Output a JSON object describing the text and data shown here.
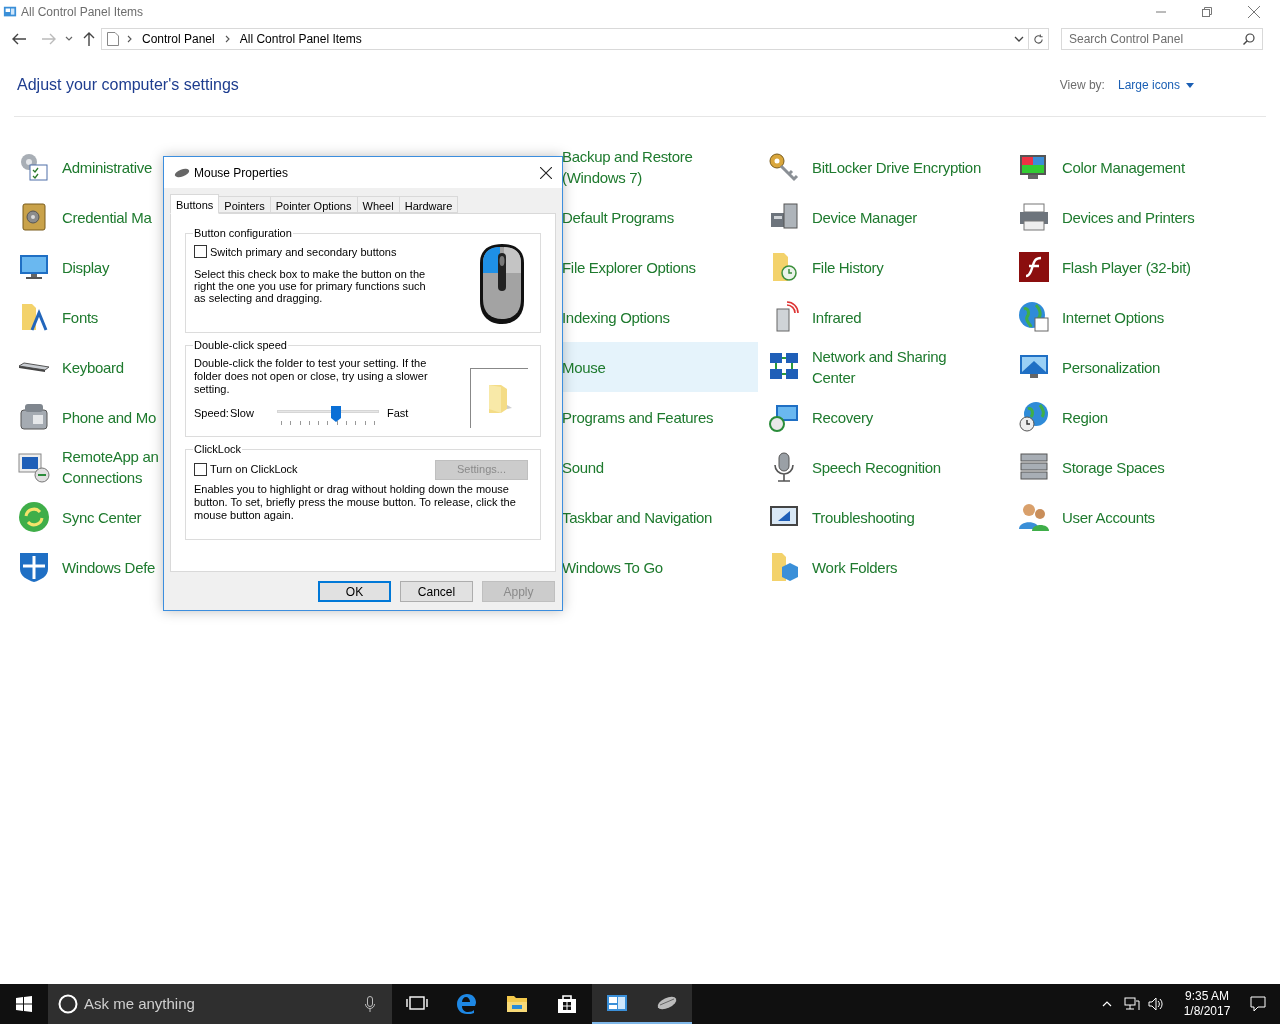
{
  "window": {
    "title": "All Control Panel Items"
  },
  "address_bar": {
    "breadcrumbs": [
      "Control Panel",
      "All Control Panel Items"
    ]
  },
  "search": {
    "placeholder": "Search Control Panel"
  },
  "heading": "Adjust your computer's settings",
  "view_by": {
    "label": "View by:",
    "value": "Large icons"
  },
  "columns": [
    {
      "items": [
        {
          "lines": [
            "Administrative"
          ],
          "selected": false
        },
        {
          "lines": [
            "Credential Ma"
          ],
          "selected": false
        },
        {
          "lines": [
            "Display"
          ],
          "selected": false
        },
        {
          "lines": [
            "Fonts"
          ],
          "selected": false
        },
        {
          "lines": [
            "Keyboard"
          ],
          "selected": false
        },
        {
          "lines": [
            "Phone and Mo"
          ],
          "selected": false
        },
        {
          "lines": [
            "RemoteApp an",
            "Connections"
          ],
          "selected": false
        },
        {
          "lines": [
            "Sync Center"
          ],
          "selected": false
        },
        {
          "lines": [
            "Windows Defe"
          ],
          "selected": false
        }
      ]
    },
    {
      "items": [
        {
          "lines": [
            "Backup and Restore",
            "(Windows 7)"
          ],
          "selected": false
        },
        {
          "lines": [
            "Default Programs"
          ],
          "selected": false
        },
        {
          "lines": [
            "File Explorer Options"
          ],
          "selected": false
        },
        {
          "lines": [
            "Indexing Options"
          ],
          "selected": false
        },
        {
          "lines": [
            "Mouse"
          ],
          "selected": true
        },
        {
          "lines": [
            "Programs and Features"
          ],
          "selected": false
        },
        {
          "lines": [
            "Sound"
          ],
          "selected": false
        },
        {
          "lines": [
            "Taskbar and Navigation"
          ],
          "selected": false
        },
        {
          "lines": [
            "Windows To Go"
          ],
          "selected": false
        }
      ]
    },
    {
      "items": [
        {
          "lines": [
            "BitLocker Drive Encryption"
          ],
          "selected": false
        },
        {
          "lines": [
            "Device Manager"
          ],
          "selected": false
        },
        {
          "lines": [
            "File History"
          ],
          "selected": false
        },
        {
          "lines": [
            "Infrared"
          ],
          "selected": false
        },
        {
          "lines": [
            "Network and Sharing",
            "Center"
          ],
          "selected": false
        },
        {
          "lines": [
            "Recovery"
          ],
          "selected": false
        },
        {
          "lines": [
            "Speech Recognition"
          ],
          "selected": false
        },
        {
          "lines": [
            "Troubleshooting"
          ],
          "selected": false
        },
        {
          "lines": [
            "Work Folders"
          ],
          "selected": false
        }
      ]
    },
    {
      "items": [
        {
          "lines": [
            "Color Management"
          ],
          "selected": false
        },
        {
          "lines": [
            "Devices and Printers"
          ],
          "selected": false
        },
        {
          "lines": [
            "Flash Player (32-bit)"
          ],
          "selected": false
        },
        {
          "lines": [
            "Internet Options"
          ],
          "selected": false
        },
        {
          "lines": [
            "Personalization"
          ],
          "selected": false
        },
        {
          "lines": [
            "Region"
          ],
          "selected": false
        },
        {
          "lines": [
            "Storage Spaces"
          ],
          "selected": false
        },
        {
          "lines": [
            "User Accounts"
          ],
          "selected": false
        }
      ]
    }
  ],
  "dialog": {
    "title": "Mouse Properties",
    "tabs": [
      {
        "label": "Buttons",
        "selected": true
      },
      {
        "label": "Pointers",
        "selected": false
      },
      {
        "label": "Pointer Options",
        "selected": false
      },
      {
        "label": "Wheel",
        "selected": false
      },
      {
        "label": "Hardware",
        "selected": false
      }
    ],
    "button_configuration": {
      "legend": "Button configuration",
      "checkbox": {
        "label": "Switch primary and secondary buttons",
        "checked": false
      },
      "description": "Select this check box to make the button on the right the one you use for primary functions such as selecting and dragging."
    },
    "double_click_speed": {
      "legend": "Double-click speed",
      "description": "Double-click the folder to test your setting. If the folder does not open or close, try using a slower setting.",
      "speed_label": "Speed:",
      "slow_label": "Slow",
      "fast_label": "Fast",
      "slider": {
        "level": 0.58
      }
    },
    "click_lock": {
      "legend": "ClickLock",
      "checkbox": {
        "label": "Turn on ClickLock",
        "checked": false
      },
      "settings_button": {
        "label": "Settings...",
        "disabled": true
      },
      "description": "Enables you to highlight or drag without holding down the mouse button. To set, briefly press the mouse button. To release, click the mouse button again."
    },
    "buttons": [
      {
        "label": "OK",
        "kind": "default"
      },
      {
        "label": "Cancel",
        "kind": "normal"
      },
      {
        "label": "Apply",
        "kind": "disabled"
      }
    ]
  },
  "taskbar": {
    "search_placeholder": "Ask me anything",
    "apps": [
      {
        "kind": "task-view",
        "selected": false
      },
      {
        "kind": "edge",
        "selected": false
      },
      {
        "kind": "explorer",
        "selected": false
      },
      {
        "kind": "store",
        "selected": false
      },
      {
        "kind": "control-panel",
        "selected": true
      },
      {
        "kind": "mouse",
        "selected": true
      }
    ],
    "time": "9:35 AM",
    "date": "1/8/2017"
  }
}
